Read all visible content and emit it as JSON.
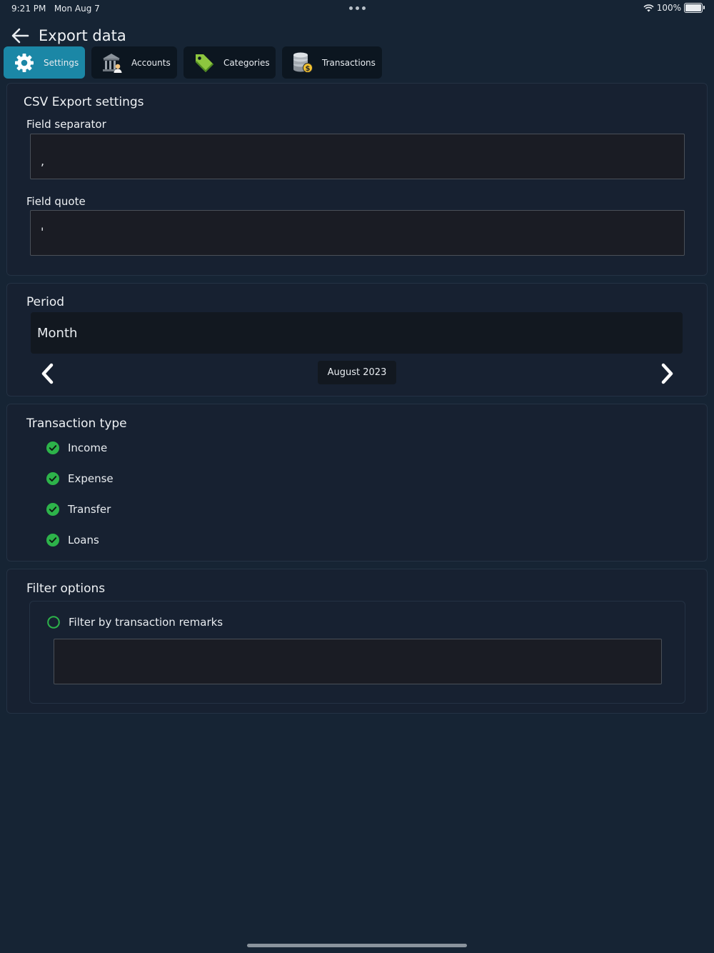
{
  "status_bar": {
    "time": "9:21 PM",
    "date": "Mon Aug 7",
    "battery": "100%"
  },
  "header": {
    "title": "Export data"
  },
  "tabs": [
    {
      "label": "Settings",
      "icon": "gear-icon",
      "active": true
    },
    {
      "label": "Accounts",
      "icon": "bank-icon",
      "active": false
    },
    {
      "label": "Categories",
      "icon": "tag-icon",
      "active": false
    },
    {
      "label": "Transactions",
      "icon": "coins-icon",
      "active": false
    }
  ],
  "csv": {
    "title": "CSV Export settings",
    "separator_label": "Field separator",
    "separator_value": ",",
    "quote_label": "Field quote",
    "quote_value": "'"
  },
  "period": {
    "title": "Period",
    "mode": "Month",
    "current": "August 2023"
  },
  "transaction_type": {
    "title": "Transaction type",
    "items": [
      {
        "label": "Income",
        "checked": true
      },
      {
        "label": "Expense",
        "checked": true
      },
      {
        "label": "Transfer",
        "checked": true
      },
      {
        "label": "Loans",
        "checked": true
      }
    ]
  },
  "filter": {
    "title": "Filter options",
    "remarks_label": "Filter by transaction remarks",
    "remarks_value": "",
    "remarks_checked": false
  },
  "colors": {
    "background": "#162434",
    "accent": "#1b87a6",
    "check": "#2db34a"
  }
}
